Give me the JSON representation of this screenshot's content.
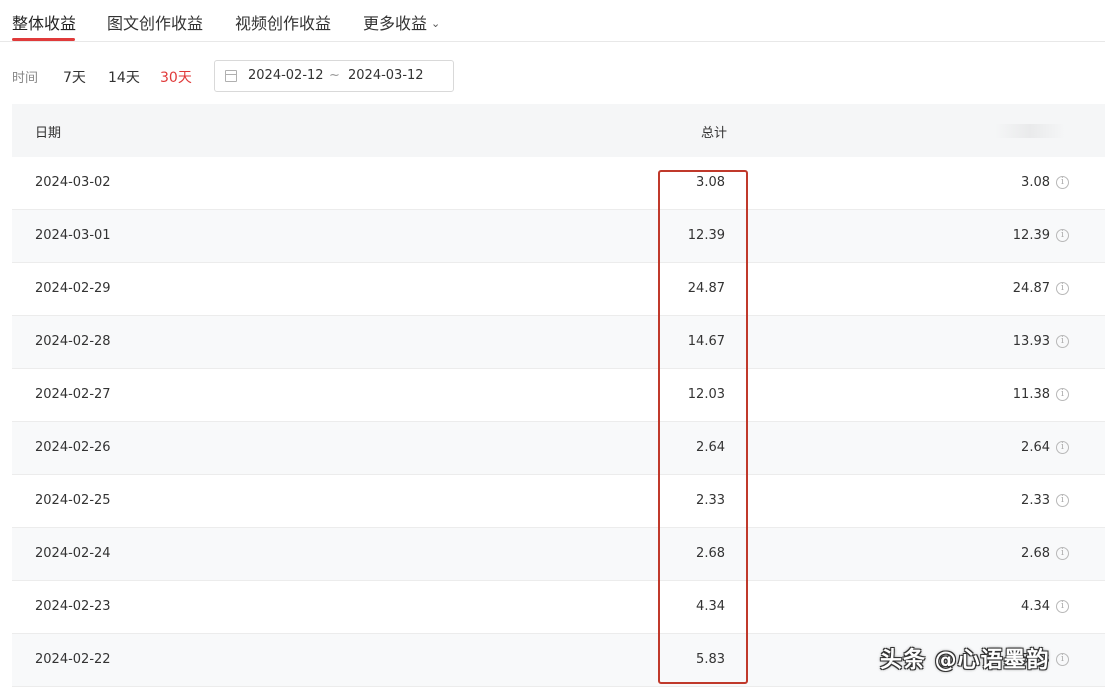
{
  "tabs": [
    {
      "label": "整体收益",
      "active": true
    },
    {
      "label": "图文创作收益",
      "active": false
    },
    {
      "label": "视频创作收益",
      "active": false
    },
    {
      "label": "更多收益",
      "active": false,
      "dropdown": true
    }
  ],
  "filter": {
    "label": "时间",
    "ranges": [
      "7天",
      "14天",
      "30天"
    ],
    "selected": "30天",
    "start_date": "2024-02-12",
    "separator": "~",
    "end_date": "2024-03-12"
  },
  "table": {
    "headers": {
      "date": "日期",
      "total": "总计"
    },
    "rows": [
      {
        "date": "2024-03-02",
        "total": "3.08",
        "other": "3.08"
      },
      {
        "date": "2024-03-01",
        "total": "12.39",
        "other": "12.39"
      },
      {
        "date": "2024-02-29",
        "total": "24.87",
        "other": "24.87"
      },
      {
        "date": "2024-02-28",
        "total": "14.67",
        "other": "13.93"
      },
      {
        "date": "2024-02-27",
        "total": "12.03",
        "other": "11.38"
      },
      {
        "date": "2024-02-26",
        "total": "2.64",
        "other": "2.64"
      },
      {
        "date": "2024-02-25",
        "total": "2.33",
        "other": "2.33"
      },
      {
        "date": "2024-02-24",
        "total": "2.68",
        "other": "2.68"
      },
      {
        "date": "2024-02-23",
        "total": "4.34",
        "other": "4.34"
      },
      {
        "date": "2024-02-22",
        "total": "5.83",
        "other": "5.83"
      }
    ]
  },
  "colors": {
    "accent": "#e03a3a",
    "highlight": "#c0392b"
  },
  "watermark": "头条 @心语墨韵"
}
